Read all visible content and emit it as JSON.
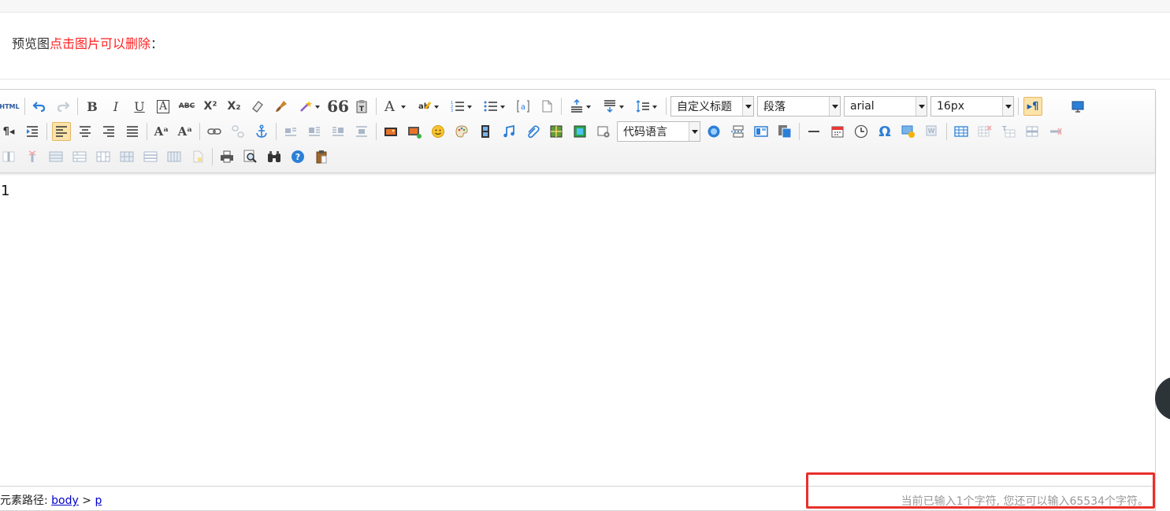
{
  "preview": {
    "label": "预览图",
    "hint": "点击图片可以删除",
    "colon": "："
  },
  "toolbar": {
    "html_label": "HTML",
    "custom_heading": "自定义标题",
    "paragraph": "段落",
    "font_family": "arial",
    "font_size": "16px",
    "code_language": "代码语言",
    "bold": "B",
    "italic": "I",
    "underline": "U",
    "superscript": "X²",
    "subscript": "X₂",
    "quote": "❝❝",
    "font_color": "A",
    "omega": "Ω"
  },
  "editor": {
    "content": "1"
  },
  "statusbar": {
    "path_label": "元素路径:",
    "path_body": "body",
    "path_sep": ">",
    "path_p": "p",
    "word_count": "当前已输入1个字符, 您还可以输入65534个字符。"
  },
  "colors": {
    "highlight": "#e8302b",
    "hint_red": "#ff2020",
    "active_button": "#fbe3a9",
    "link": "#0000cc"
  }
}
